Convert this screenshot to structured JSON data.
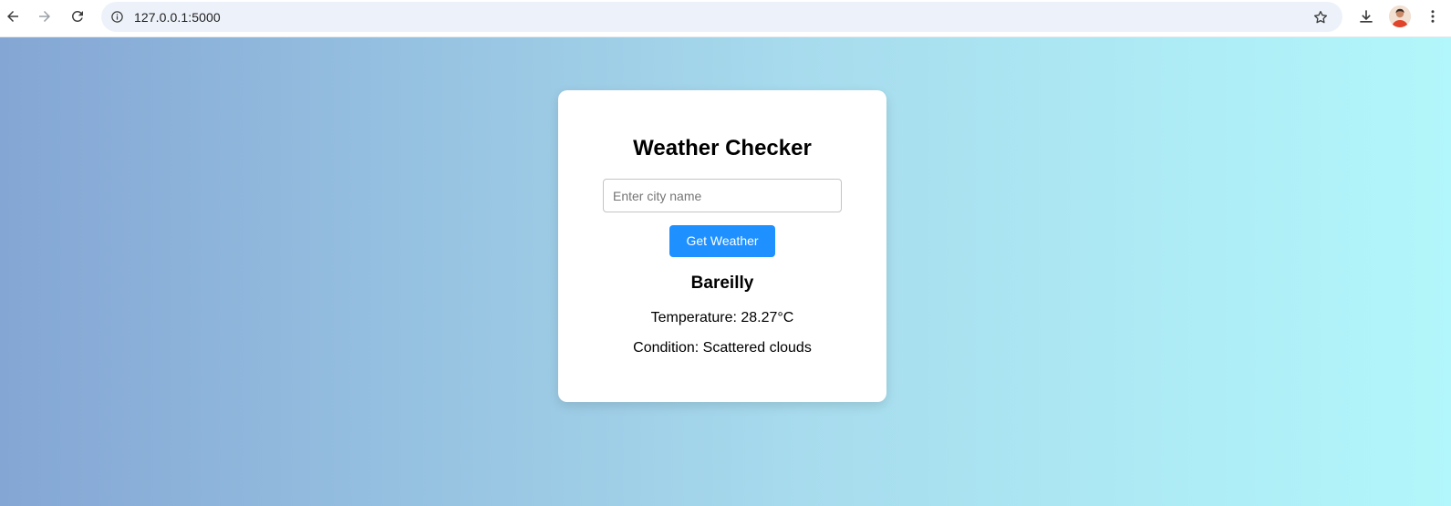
{
  "browser": {
    "url": "127.0.0.1:5000",
    "icons": {
      "back": "arrow-left-icon",
      "forward": "arrow-right-icon",
      "reload": "reload-icon",
      "site_info": "info-icon",
      "bookmark": "star-icon",
      "downloads": "download-icon",
      "menu": "kebab-menu-icon"
    }
  },
  "app": {
    "title": "Weather Checker",
    "city_input": {
      "placeholder": "Enter city name",
      "value": ""
    },
    "submit_label": "Get Weather",
    "result": {
      "city": "Bareilly",
      "temperature_text": "Temperature: 28.27°C",
      "condition_text": "Condition: Scattered clouds"
    }
  },
  "colors": {
    "background_gradient_start": "#84a6d4",
    "background_gradient_end": "#b2f7fb",
    "button": "#1e90ff",
    "card": "#ffffff"
  }
}
